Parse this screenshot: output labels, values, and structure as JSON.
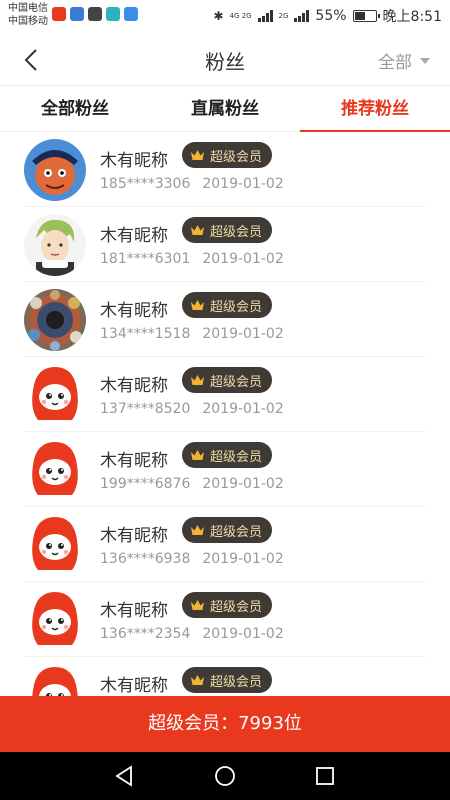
{
  "status_bar": {
    "carrier1": "中国电信",
    "carrier2": "中国移动",
    "network": "4G 2G",
    "signal2": "2G",
    "battery_text": "55%",
    "battery_level": 0.55,
    "time": "晚上8:51"
  },
  "header": {
    "title": "粉丝",
    "filter_label": "全部"
  },
  "tabs": [
    {
      "label": "全部粉丝",
      "active": false
    },
    {
      "label": "直属粉丝",
      "active": false
    },
    {
      "label": "推荐粉丝",
      "active": true
    }
  ],
  "fans": [
    {
      "avatar": "cartoon-boy-avatar",
      "nickname": "木有昵称",
      "badge": "超级会员",
      "phone": "185****3306",
      "date": "2019-01-02"
    },
    {
      "avatar": "anime-boy-avatar",
      "nickname": "木有昵称",
      "badge": "超级会员",
      "phone": "181****6301",
      "date": "2019-01-02"
    },
    {
      "avatar": "group-photo-avatar",
      "nickname": "木有昵称",
      "badge": "超级会员",
      "phone": "134****1518",
      "date": "2019-01-02"
    },
    {
      "avatar": "red-mascot-avatar",
      "nickname": "木有昵称",
      "badge": "超级会员",
      "phone": "137****8520",
      "date": "2019-01-02"
    },
    {
      "avatar": "red-mascot-avatar",
      "nickname": "木有昵称",
      "badge": "超级会员",
      "phone": "199****6876",
      "date": "2019-01-02"
    },
    {
      "avatar": "red-mascot-avatar",
      "nickname": "木有昵称",
      "badge": "超级会员",
      "phone": "136****6938",
      "date": "2019-01-02"
    },
    {
      "avatar": "red-mascot-avatar",
      "nickname": "木有昵称",
      "badge": "超级会员",
      "phone": "136****2354",
      "date": "2019-01-02"
    },
    {
      "avatar": "red-mascot-avatar",
      "nickname": "木有昵称",
      "badge": "超级会员",
      "phone": "",
      "date": ""
    }
  ],
  "bottom_bar": {
    "text": "超级会员：7993位"
  },
  "colors": {
    "accent": "#e8391e",
    "badge_bg": "#3f3a35",
    "badge_text": "#f0d9a8"
  }
}
